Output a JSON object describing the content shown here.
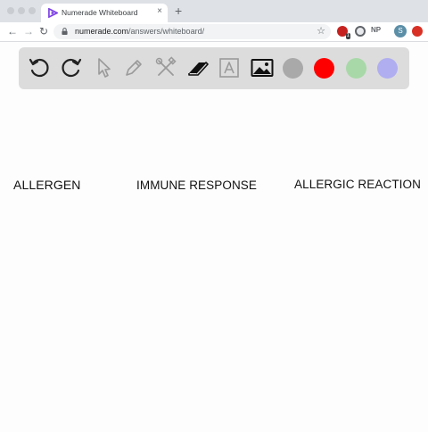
{
  "browser": {
    "tab_title": "Numerade Whiteboard",
    "tab_close": "×",
    "new_tab": "+",
    "url_host": "numerade.com",
    "url_path": "/answers/whiteboard/",
    "back": "←",
    "forward": "→",
    "reload": "↻",
    "bookmark": "☆",
    "ext_np": "NP",
    "ext_badge": "1",
    "profile_initial": "S"
  },
  "tools": [
    {
      "name": "undo-icon",
      "enabled": true
    },
    {
      "name": "redo-icon",
      "enabled": true
    },
    {
      "name": "pointer-icon",
      "enabled": false
    },
    {
      "name": "pencil-icon",
      "enabled": false
    },
    {
      "name": "tools-icon",
      "enabled": false
    },
    {
      "name": "eraser-icon",
      "enabled": true
    },
    {
      "name": "text-box-icon",
      "enabled": false
    },
    {
      "name": "image-icon",
      "enabled": true
    }
  ],
  "colors": {
    "gray": "#a9a9a9",
    "red": "#ff0000",
    "green": "#a8d8a8",
    "purple": "#b0aef0"
  },
  "canvas": {
    "labels": [
      "ALLERGEN",
      "IMMUNE RESPONSE",
      "ALLERGIC REACTION"
    ]
  }
}
